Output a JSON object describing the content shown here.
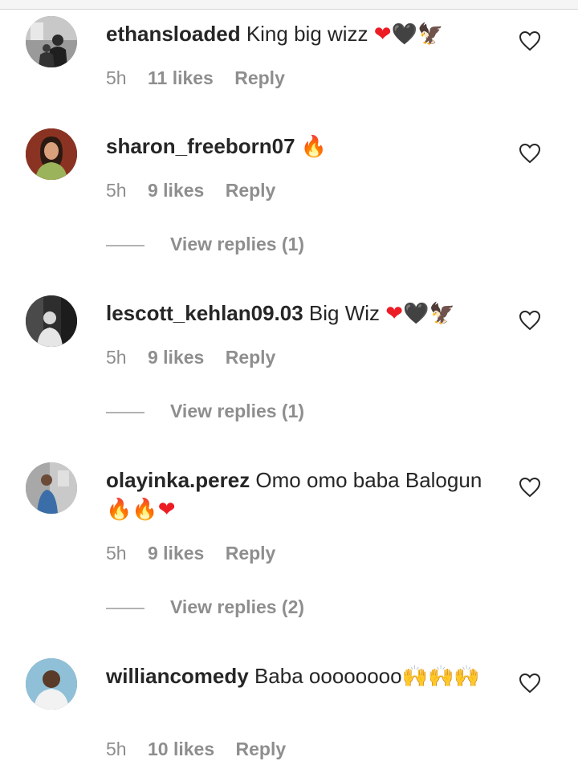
{
  "comments": [
    {
      "username": "ethansloaded",
      "text": " King big wizz ",
      "emojis": [
        "❤",
        "🖤",
        "🦅"
      ],
      "time": "5h",
      "likes": "11 likes",
      "reply": "Reply",
      "view_replies": ""
    },
    {
      "username": "sharon_freeborn07",
      "text": " ",
      "emojis": [
        "🔥"
      ],
      "time": "5h",
      "likes": "9 likes",
      "reply": "Reply",
      "view_replies": "View replies (1)"
    },
    {
      "username": "lescott_kehlan09.03",
      "text": " Big Wiz ",
      "emojis": [
        "❤",
        "🖤",
        "🦅"
      ],
      "time": "5h",
      "likes": "9 likes",
      "reply": "Reply",
      "view_replies": "View replies (1)"
    },
    {
      "username": "olayinka.perez",
      "text": " Omo omo baba Balogun ",
      "emojis": [
        "🔥",
        "🔥",
        "❤"
      ],
      "time": "5h",
      "likes": "9 likes",
      "reply": "Reply",
      "view_replies": "View replies (2)"
    },
    {
      "username": "williancomedy",
      "text": " Baba oooooooo",
      "emojis": [
        "🙌",
        "🙌",
        "🙌"
      ],
      "time": "5h",
      "likes": "10 likes",
      "reply": "Reply",
      "view_replies": ""
    }
  ],
  "colors": {
    "text": "#262626",
    "muted": "#8e8e8e",
    "heart_red": "#ed1c24"
  }
}
